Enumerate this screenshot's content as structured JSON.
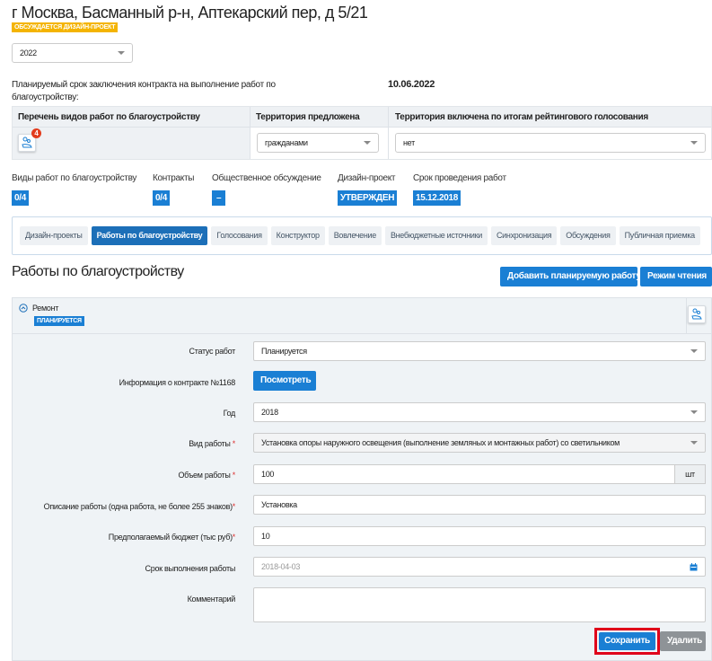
{
  "header": {
    "title": "г Москва, Басманный р-н, Аптекарский пер, д 5/21",
    "status_badge": "ОБСУЖДАЕТСЯ ДИЗАЙН-ПРОЕКТ",
    "year_select": "2022"
  },
  "contract": {
    "label": "Планируемый срок заключения контракта на выполнение работ по благоустройству:",
    "date": "10.06.2022"
  },
  "table": {
    "headers": [
      "Перечень видов работ по благоустройству",
      "Территория предложена",
      "Территория включена по итогам рейтингового голосования"
    ],
    "work_count": "4",
    "proposed_by": "гражданами",
    "included": "нет"
  },
  "stats": [
    {
      "label": "Виды работ по благоустройству",
      "value": "0/4"
    },
    {
      "label": "Контракты",
      "value": "0/4"
    },
    {
      "label": "Общественное обсуждение",
      "value": "–"
    },
    {
      "label": "Дизайн-проект",
      "value": "УТВЕРЖДЕН"
    },
    {
      "label": "Срок проведения работ",
      "value": "15.12.2018"
    }
  ],
  "tabs": [
    {
      "label": "Дизайн-проекты"
    },
    {
      "label": "Работы по благоустройству",
      "active": true
    },
    {
      "label": "Голосования"
    },
    {
      "label": "Конструктор"
    },
    {
      "label": "Вовлечение"
    },
    {
      "label": "Внебюджетные источники"
    },
    {
      "label": "Синхронизация"
    },
    {
      "label": "Обсуждения"
    },
    {
      "label": "Публичная приемка"
    }
  ],
  "section": {
    "title": "Работы по благоустройству",
    "add_button": "Добавить планируемую работу",
    "read_mode_button": "Режим чтения"
  },
  "work": {
    "name": "Ремонт",
    "status_badge": "ПЛАНИРУЕТСЯ",
    "form": {
      "status_label": "Статус работ",
      "status_value": "Планируется",
      "contract_label": "Информация о контракте №1168",
      "view_button": "Посмотреть",
      "year_label": "Год",
      "year_value": "2018",
      "type_label": "Вид работы",
      "type_value": "Установка опоры наружного освещения (выполнение земляных и монтажных работ) со светильником",
      "volume_label": "Объем работы",
      "volume_value": "100",
      "volume_unit": "шт",
      "desc_label": "Описание работы (одна работа, не более 255 знаков)",
      "desc_value": "Установка",
      "budget_label": "Предполагаемый бюджет (тыс руб)",
      "budget_value": "10",
      "deadline_label": "Срок выполнения работы",
      "deadline_value": "2018-04-03",
      "comment_label": "Комментарий",
      "comment_value": "",
      "save_button": "Сохранить",
      "delete_button": "Удалить"
    }
  },
  "colors": {
    "primary": "#1a7fd4",
    "badge_yellow": "#f4b400",
    "highlight": "#e0001a"
  }
}
